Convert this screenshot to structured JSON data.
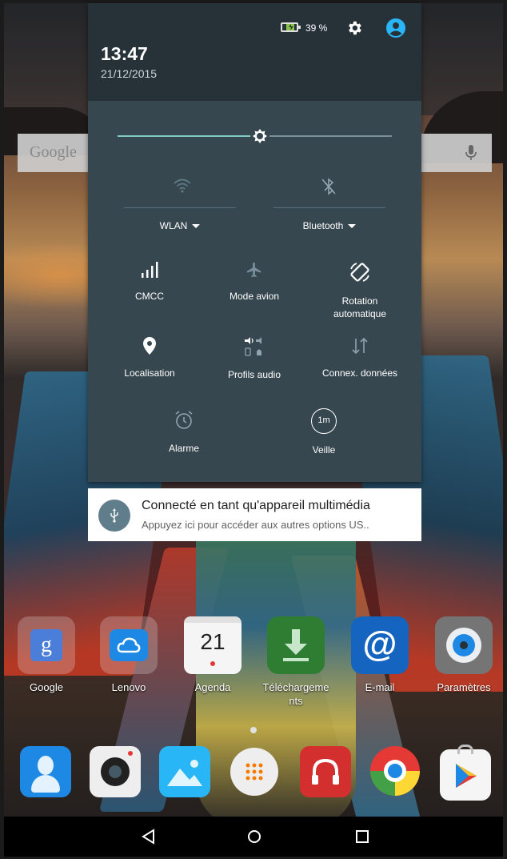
{
  "status": {
    "time": "13:47",
    "date": "21/12/2015",
    "battery_percent": "39 %"
  },
  "brightness": {
    "level": 0.52
  },
  "quick_settings": {
    "wlan_label": "WLAN",
    "bluetooth_label": "Bluetooth",
    "tiles": [
      {
        "label": "CMCC"
      },
      {
        "label": "Mode avion"
      },
      {
        "label_line1": "Rotation",
        "label_line2": "automatique"
      },
      {
        "label": "Localisation"
      },
      {
        "label": "Profils audio"
      },
      {
        "label": "Connex. données"
      },
      {
        "label": "Alarme"
      },
      {
        "label": "Veille",
        "icon_text": "1m"
      }
    ]
  },
  "notification": {
    "title": "Connecté en tant qu'appareil multimédia",
    "text": "Appuyez ici pour accéder aux autres options US.."
  },
  "home": {
    "search_logo": "Google",
    "apps": [
      {
        "label": "Google",
        "icon": "google-folder-icon"
      },
      {
        "label": "Lenovo",
        "icon": "lenovo-cloud-icon"
      },
      {
        "label": "Agenda",
        "icon_text": "21",
        "icon": "calendar-icon"
      },
      {
        "label_line1": "Téléchargeme",
        "label_line2": "nts",
        "icon": "download-icon"
      },
      {
        "label": "E-mail",
        "icon": "email-icon"
      },
      {
        "label": "Paramètres",
        "icon": "settings-icon"
      }
    ],
    "dock": [
      {
        "icon": "contacts-icon"
      },
      {
        "icon": "camera-icon"
      },
      {
        "icon": "gallery-icon"
      },
      {
        "icon": "app-drawer-icon"
      },
      {
        "icon": "music-icon"
      },
      {
        "icon": "chrome-icon"
      },
      {
        "icon": "play-store-icon"
      }
    ]
  },
  "colors": {
    "panel": "#37474f",
    "header": "#263238",
    "accent": "#80cbc4"
  }
}
